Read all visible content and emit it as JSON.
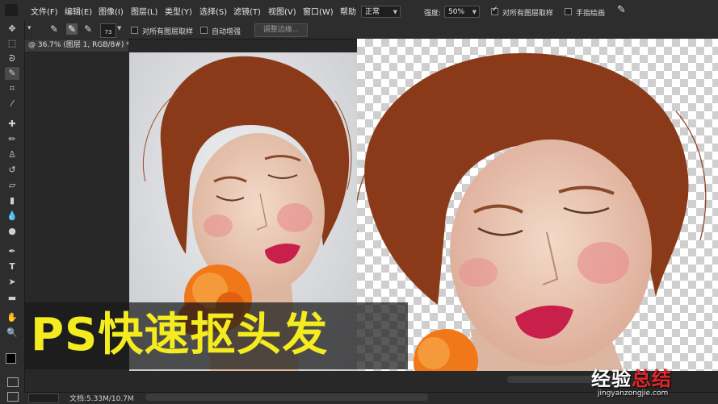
{
  "menubar": {
    "items": [
      "文件(F)",
      "编辑(E)",
      "图像(I)",
      "图层(L)",
      "类型(Y)",
      "选择(S)",
      "滤镜(T)",
      "视图(V)",
      "窗口(W)",
      "帮助"
    ],
    "mode_value": "正常",
    "strength_label": "强度:",
    "strength_value": "50%",
    "sample_all_layers_label": "对所有图层取样",
    "finger_paint_label": "手指绘画"
  },
  "options": {
    "brush_size": "73",
    "sample_all_layers_label": "对所有图层取样",
    "auto_enhance_label": "自动增强",
    "refine_edge_button": "调整边缘..."
  },
  "doc_tab": {
    "title": "@ 36.7% (图层 1, RGB/8#) *"
  },
  "tools": [
    "move-tool",
    "marquee-tool",
    "lasso-tool",
    "quick-selection-tool",
    "crop-tool",
    "eyedropper-tool",
    "healing-brush-tool",
    "brush-tool",
    "clone-stamp-tool",
    "history-brush-tool",
    "eraser-tool",
    "gradient-tool",
    "blur-tool",
    "dodge-tool",
    "pen-tool",
    "type-tool",
    "path-selection-tool",
    "shape-tool",
    "hand-tool",
    "zoom-tool"
  ],
  "banner": {
    "title": "PS快速抠头发"
  },
  "status": {
    "doc_size": "文档:5.33M/10.7M"
  },
  "watermark": {
    "part1": "经验",
    "part2": "总结",
    "url": "jingyanzongjie.com"
  },
  "colors": {
    "accent_yellow": "#f4ec1f",
    "hair": "#8a3a18",
    "skin": "#e9c5b0",
    "lips": "#c8204a",
    "rose": "#f07818"
  }
}
